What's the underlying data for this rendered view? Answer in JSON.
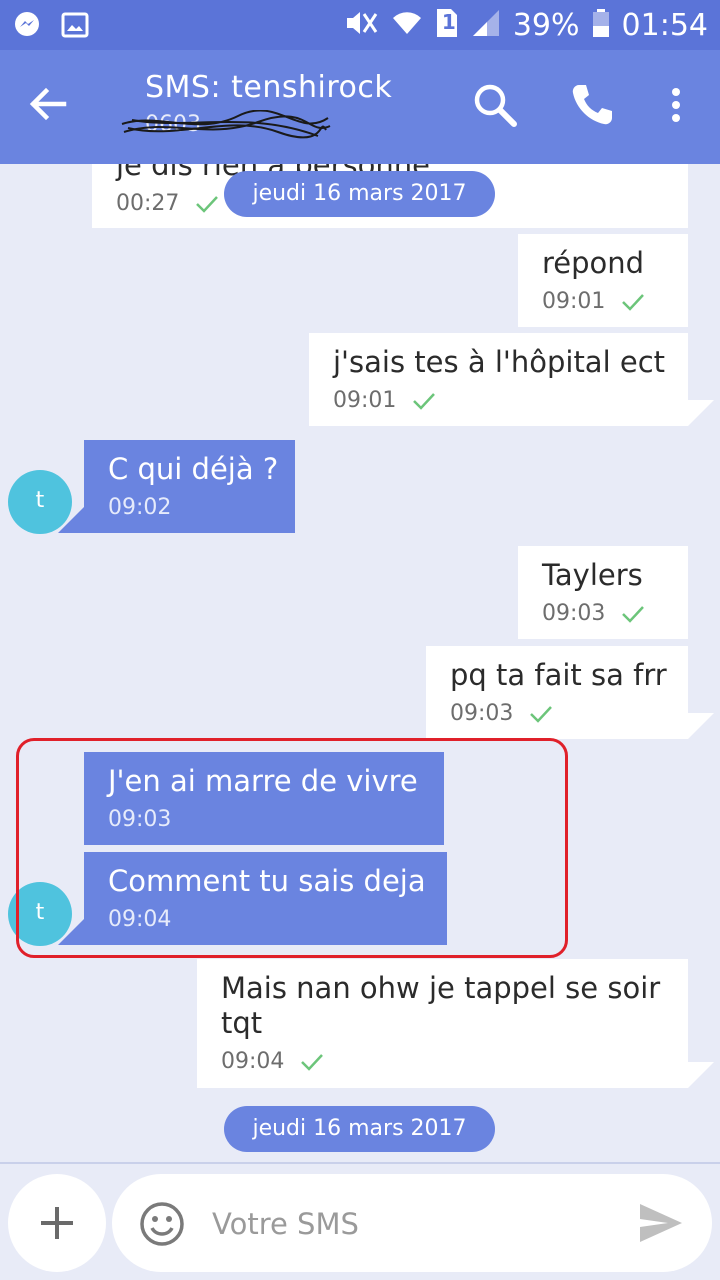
{
  "status_bar": {
    "sim_label": "1",
    "battery": "39%",
    "time": "01:54"
  },
  "header": {
    "title": "SMS: tenshirock",
    "subtitle": "0603"
  },
  "date_separators": {
    "top": "jeudi 16 mars 2017",
    "bottom": "jeudi 16 mars 2017"
  },
  "messages": [
    {
      "direction": "outgoing",
      "text": "je dis rien à personne",
      "time": "00:27"
    },
    {
      "direction": "outgoing",
      "text": "répond",
      "time": "09:01"
    },
    {
      "direction": "outgoing",
      "text": "j'sais tes à l'hôpital ect",
      "time": "09:01"
    },
    {
      "direction": "incoming",
      "text": "C qui déjà ?",
      "time": "09:02",
      "avatar": "t"
    },
    {
      "direction": "outgoing",
      "text": "Taylers",
      "time": "09:03"
    },
    {
      "direction": "outgoing",
      "text": "pq ta fait sa frr",
      "time": "09:03"
    },
    {
      "direction": "incoming",
      "text": "J'en ai marre de vivre",
      "time": "09:03"
    },
    {
      "direction": "incoming",
      "text": "Comment tu sais deja",
      "time": "09:04",
      "avatar": "t"
    },
    {
      "direction": "outgoing",
      "text": "Mais nan ohw je tappel se soir tqt",
      "time": "09:04"
    }
  ],
  "composer": {
    "placeholder": "Votre SMS",
    "value": ""
  },
  "colors": {
    "status_bar": "#5b74d8",
    "app_bar": "#6a84e0",
    "incoming_bubble": "#6a84e0",
    "outgoing_bubble": "#ffffff",
    "background": "#e8ebf7",
    "avatar": "#4fc3de",
    "read_check": "#6cc57a",
    "highlight": "#e0202a"
  },
  "icons": {
    "status_left": [
      "messenger-icon",
      "gallery-icon"
    ],
    "status_right": [
      "mute-icon",
      "wifi-icon",
      "sim-icon",
      "signal-icon",
      "battery-icon"
    ],
    "header": [
      "back-arrow-icon",
      "search-icon",
      "phone-icon",
      "more-vert-icon"
    ],
    "composer": [
      "plus-icon",
      "emoji-icon",
      "send-icon"
    ]
  }
}
